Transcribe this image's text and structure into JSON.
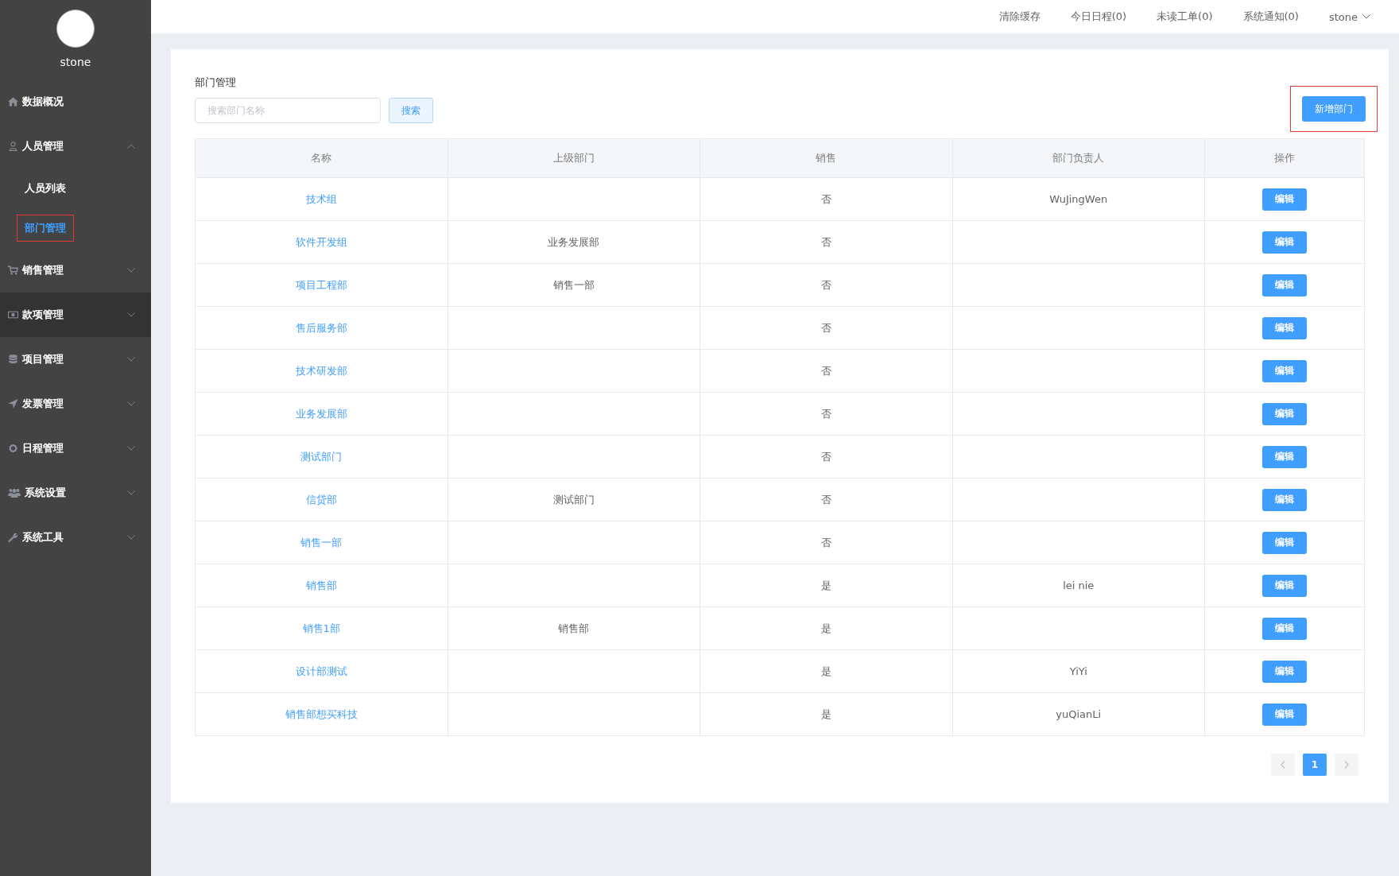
{
  "sidebar": {
    "user_name": "stone",
    "items": [
      {
        "kind": "link",
        "label": "数据概况",
        "hovered": false
      },
      {
        "kind": "group",
        "label": "人员管理",
        "expanded": true,
        "hovered": false,
        "children": [
          {
            "label": "人员列表",
            "selected": false,
            "marked": false
          },
          {
            "label": "部门管理",
            "selected": true,
            "marked": true
          }
        ]
      },
      {
        "kind": "group",
        "label": "销售管理",
        "expanded": false,
        "hovered": false
      },
      {
        "kind": "group",
        "label": "款项管理",
        "expanded": false,
        "hovered": true
      },
      {
        "kind": "group",
        "label": "项目管理",
        "expanded": false,
        "hovered": false
      },
      {
        "kind": "group",
        "label": "发票管理",
        "expanded": false,
        "hovered": false
      },
      {
        "kind": "group",
        "label": "日程管理",
        "expanded": false,
        "hovered": false
      },
      {
        "kind": "group",
        "label": "系统设置",
        "expanded": false,
        "hovered": false
      },
      {
        "kind": "group",
        "label": "系统工具",
        "expanded": false,
        "hovered": false
      }
    ]
  },
  "top_bar": {
    "links": [
      "清除缓存",
      "今日日程(0)",
      "未读工单(0)",
      "系统通知(0)"
    ],
    "user": "stone"
  },
  "page": {
    "title": "部门管理",
    "search": {
      "placeholder": "搜索部门名称",
      "button": "搜索"
    },
    "add_button": {
      "label": "新增部门",
      "marked": true
    },
    "table": {
      "columns": [
        "名称",
        "上级部门",
        "销售",
        "部门负责人",
        "操作"
      ],
      "rows": [
        {
          "name": "技术组",
          "parent": "",
          "sales": "否",
          "head": "WuJingWen",
          "action": "编辑"
        },
        {
          "name": "软件开发组",
          "parent": "业务发展部",
          "sales": "否",
          "head": "",
          "action": "编辑"
        },
        {
          "name": "项目工程部",
          "parent": "销售一部",
          "sales": "否",
          "head": "",
          "action": "编辑"
        },
        {
          "name": "售后服务部",
          "parent": "",
          "sales": "否",
          "head": "",
          "action": "编辑"
        },
        {
          "name": "技术研发部",
          "parent": "",
          "sales": "否",
          "head": "",
          "action": "编辑"
        },
        {
          "name": "业务发展部",
          "parent": "",
          "sales": "否",
          "head": "",
          "action": "编辑"
        },
        {
          "name": "测试部门",
          "parent": "",
          "sales": "否",
          "head": "",
          "action": "编辑"
        },
        {
          "name": "信贷部",
          "parent": "测试部门",
          "sales": "否",
          "head": "",
          "action": "编辑"
        },
        {
          "name": "销售一部",
          "parent": "",
          "sales": "否",
          "head": "",
          "action": "编辑"
        },
        {
          "name": "销售部",
          "parent": "",
          "sales": "是",
          "head": "lei nie",
          "action": "编辑"
        },
        {
          "name": "销售1部",
          "parent": "销售部",
          "sales": "是",
          "head": "",
          "action": "编辑"
        },
        {
          "name": "设计部测试",
          "parent": "",
          "sales": "是",
          "head": "YiYi",
          "action": "编辑"
        },
        {
          "name": "销售部想买科技",
          "parent": "",
          "sales": "是",
          "head": "yuQianLi",
          "action": "编辑"
        }
      ]
    },
    "pagination": {
      "pages": [
        {
          "label": "1",
          "selected": true
        }
      ]
    }
  }
}
